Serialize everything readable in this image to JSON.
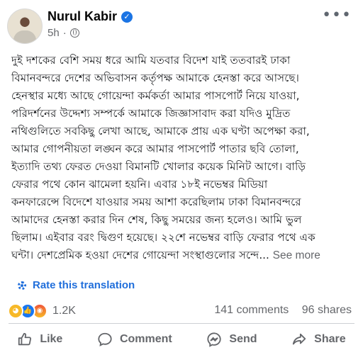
{
  "post": {
    "author": "Nurul Kabir",
    "time": "5h",
    "dot": "·",
    "text": "দুই দশকের বেশি সময় ধরে আমি যতবার বিদেশ যাই ততবারই ঢাকা\nবিমানবন্দরে দেশের অভিবাসন কর্তৃপক্ষ আমাকে হেনস্তা করে আসছে।\nহেনস্থার মধ্যে আছে গোয়েন্দা কর্মকর্তা আমার পাসপোর্ট নিয়ে যাওয়া,\nপরিদর্শনের উদ্দেশ্য সম্পর্কে আমাকে জিজ্ঞাসাবাদ করা যদিও মুদ্রিত\nনথিগুলিতে সবকিছু লেখা আছে, আমাকে প্রায় এক ঘণ্টা অপেক্ষা করা,\nআমার গোপনীয়তা লঙ্ঘন করে আমার পাসপোর্ট পাতার ছবি তোলা,\nইত্যাদি তথ্য ফেরত দেওয়া বিমানটি খোলার কয়েক মিনিট আগে। বাড়ি\nফেরার পথে কোন ঝামেলা হয়নি। এবার ১৮ই নভেম্বর মিডিয়া\nকনফারেন্সে বিদেশে যাওয়ার সময় আশা করেছিলাম ঢাকা বিমানবন্দরে\nআমাদের হেনস্তা করার দিন শেষ, কিছু সময়ের জন্য হলেও। আমি ভুল\nছিলাম। এইবার বরং দ্বিগুণ হয়েছে। ২২শে নভেম্বর বাড়ি ফেরার পথে এক\nঘন্টা। দেশপ্রেমিক হওয়া দেশের গোয়েন্দা সংস্থাগুলোর সন্দে...",
    "see_more": "See more",
    "translate": "Rate this translation"
  },
  "stats": {
    "reaction_count": "1.2K",
    "comments": "141 comments",
    "shares": "96 shares"
  },
  "actions": {
    "like": "Like",
    "comment": "Comment",
    "send": "Send",
    "share": "Share"
  },
  "colors": {
    "link": "#216fdb",
    "muted": "#65676b",
    "verified": "#1b74e4"
  }
}
